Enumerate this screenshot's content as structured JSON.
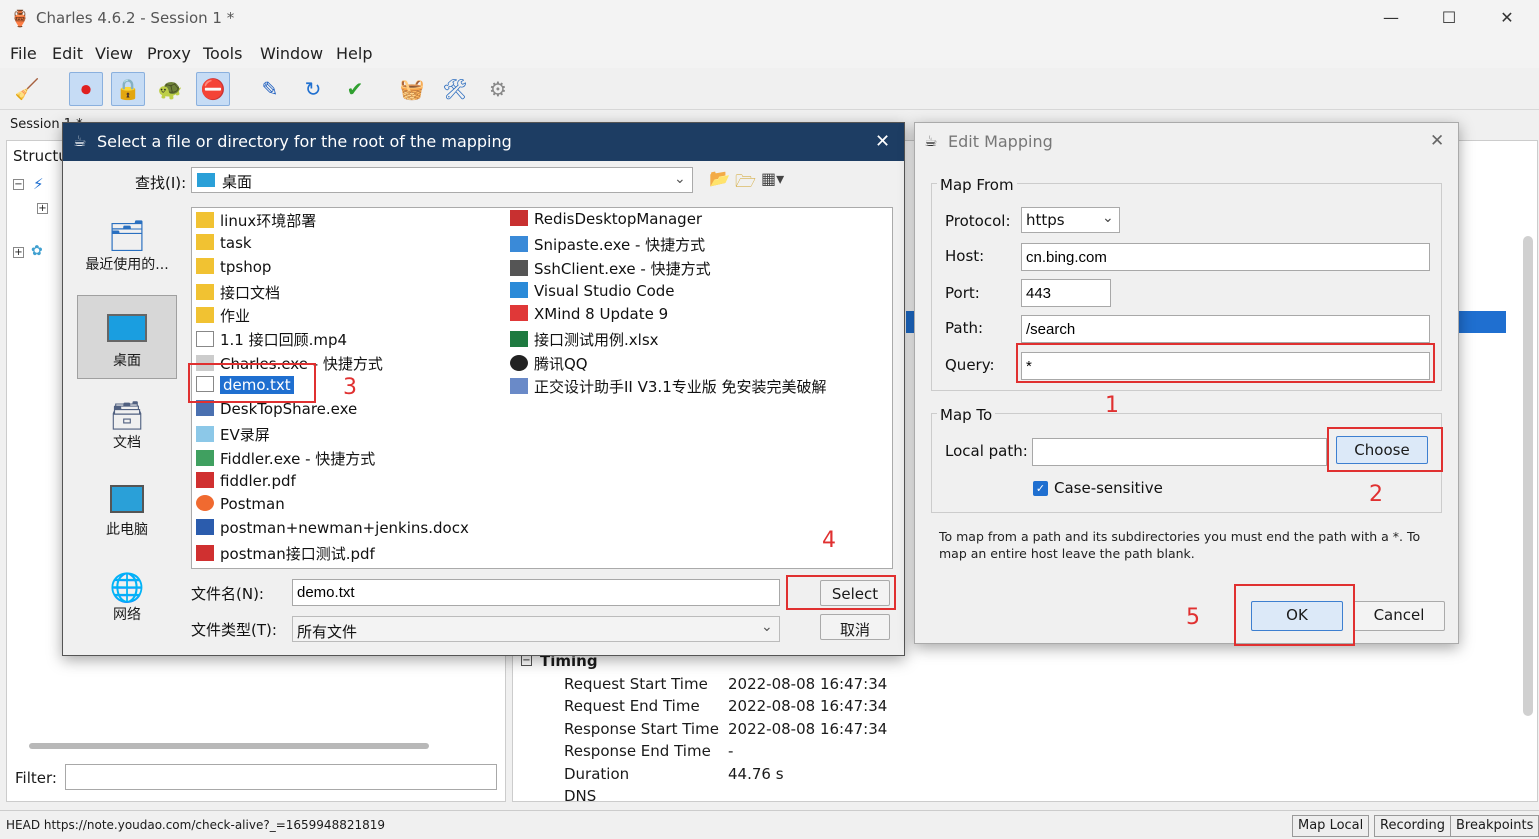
{
  "app": {
    "title": "Charles 4.6.2 - Session 1 *"
  },
  "menu": [
    "File",
    "Edit",
    "View",
    "Proxy",
    "Tools",
    "Window",
    "Help"
  ],
  "session_tab": "Session 1 *",
  "left_panel": {
    "header": "Structu",
    "filter_label": "Filter:",
    "filter_value": ""
  },
  "timing": {
    "section": "Timing",
    "rows": [
      {
        "label": "Request Start Time",
        "value": "2022-08-08 16:47:34"
      },
      {
        "label": "Request End Time",
        "value": "2022-08-08 16:47:34"
      },
      {
        "label": "Response Start Time",
        "value": "2022-08-08 16:47:34"
      },
      {
        "label": "Response End Time",
        "value": "-"
      },
      {
        "label": "Duration",
        "value": "44.76 s"
      },
      {
        "label": "DNS",
        "value": ""
      }
    ]
  },
  "status": {
    "url": "HEAD https://note.youdao.com/check-alive?_=1659948821819",
    "buttons": [
      "Map Local",
      "Recording",
      "Breakpoints"
    ]
  },
  "file_dialog": {
    "title": "Select a file or directory for the root of the mapping",
    "lookin_label": "查找(I):",
    "lookin_value": "桌面",
    "nav": [
      "最近使用的...",
      "桌面",
      "文档",
      "此电脑",
      "网络"
    ],
    "files_col1": [
      "linux环境部署",
      "task",
      "tpshop",
      "接口文档",
      "作业",
      "1.1 接口回顾.mp4",
      "Charles.exe - 快捷方式",
      "demo.txt",
      "DeskTopShare.exe",
      "EV录屏",
      "Fiddler.exe - 快捷方式",
      "fiddler.pdf",
      "Postman",
      "postman+newman+jenkins.docx",
      "postman接口测试.pdf"
    ],
    "files_col2": [
      "RedisDesktopManager",
      "Snipaste.exe - 快捷方式",
      "SshClient.exe - 快捷方式",
      "Visual Studio Code",
      "XMind 8 Update 9",
      "接口测试用例.xlsx",
      "腾讯QQ",
      "正交设计助手II V3.1专业版 免安装完美破解"
    ],
    "filename_label": "文件名(N):",
    "filename_value": "demo.txt",
    "filetype_label": "文件类型(T):",
    "filetype_value": "所有文件",
    "select_btn": "Select",
    "cancel_btn": "取消"
  },
  "edit_mapping": {
    "title": "Edit Mapping",
    "map_from": "Map From",
    "protocol_label": "Protocol:",
    "protocol_value": "https",
    "host_label": "Host:",
    "host_value": "cn.bing.com",
    "port_label": "Port:",
    "port_value": "443",
    "path_label": "Path:",
    "path_value": "/search",
    "query_label": "Query:",
    "query_value": "*",
    "map_to": "Map To",
    "local_label": "Local path:",
    "local_value": "",
    "choose_btn": "Choose",
    "case_label": "Case-sensitive",
    "case_checked": true,
    "hint": "To map from a path and its subdirectories you must end the path with a *. To map an entire host leave the path blank.",
    "ok_btn": "OK",
    "cancel_btn": "Cancel"
  },
  "annotations": [
    "1",
    "2",
    "3",
    "4",
    "5"
  ]
}
